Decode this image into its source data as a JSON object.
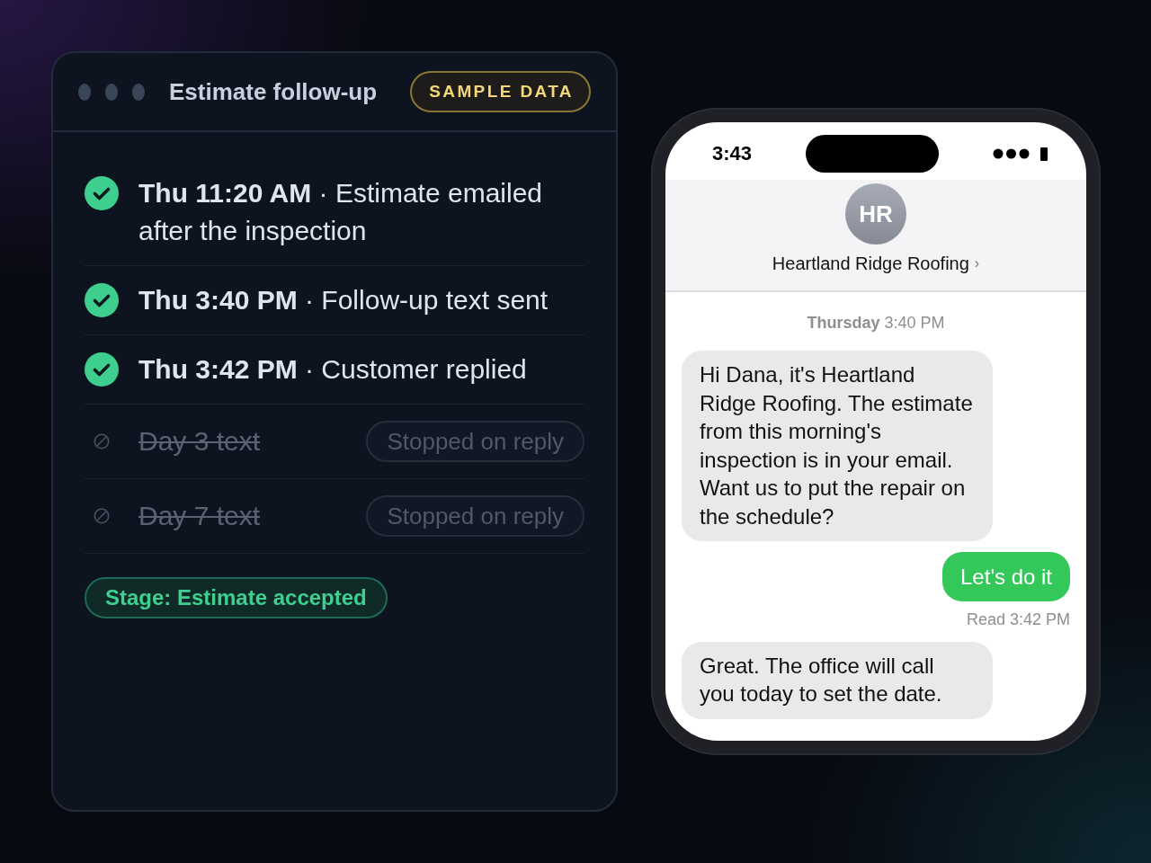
{
  "window": {
    "title": "Estimate follow-up",
    "badge": "SAMPLE DATA"
  },
  "timeline": [
    {
      "kind": "done",
      "text": "**Thu 11:20 AM** · Estimate emailed after the inspection"
    },
    {
      "kind": "done",
      "text": "**Thu 3:40 PM** · Follow-up text sent"
    },
    {
      "kind": "done",
      "text": "**Thu 3:42 PM** · Customer replied"
    },
    {
      "kind": "stopped",
      "text": "Day 3 text",
      "status": "Stopped on reply"
    },
    {
      "kind": "stopped",
      "text": "Day 7 text",
      "status": "Stopped on reply"
    }
  ],
  "stage": {
    "label": "Stage: Estimate accepted"
  },
  "phone": {
    "status_bar": {
      "time": "3:43"
    },
    "contact": {
      "initials": "HR",
      "name": "Heartland Ridge Roofing",
      "chevron": "›"
    },
    "messages": [
      {
        "kind": "timestamp",
        "text": "**Thursday** 3:40 PM"
      },
      {
        "kind": "incoming",
        "text": "Hi Dana, it's Heartland Ridge Roofing. The estimate from this morning's inspection is in your email. Want us to put the repair on the schedule?"
      },
      {
        "kind": "outgoing",
        "text": "Let's do it"
      },
      {
        "kind": "receipt",
        "text": "Read 3:42 PM"
      },
      {
        "kind": "incoming",
        "text": "Great. The office will call you today to set the date."
      }
    ]
  }
}
